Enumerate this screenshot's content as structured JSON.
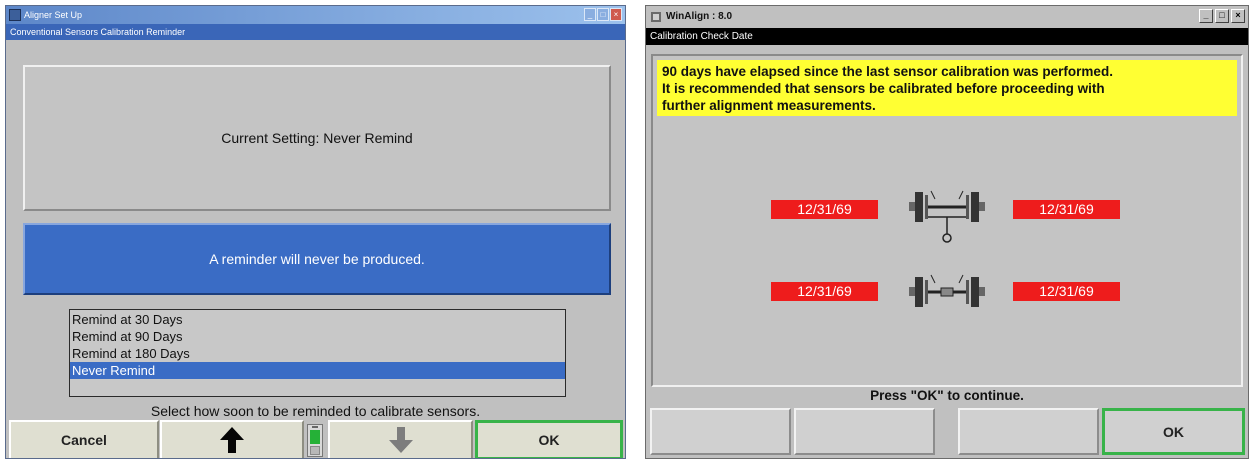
{
  "left_window": {
    "title": "Aligner Set Up",
    "subtitle": "Conventional Sensors Calibration Reminder",
    "current_setting": "Current Setting:  Never Remind",
    "reminder_message": "A reminder will never be produced.",
    "options": [
      {
        "label": "Remind at 30 Days",
        "selected": false
      },
      {
        "label": "Remind at 90 Days",
        "selected": false
      },
      {
        "label": "Remind at 180 Days",
        "selected": false
      },
      {
        "label": "Never Remind",
        "selected": true
      }
    ],
    "instruction": "Select how soon to be reminded to calibrate sensors.",
    "buttons": {
      "cancel": "Cancel",
      "up_icon": "arrow-up-icon",
      "down_icon": "arrow-down-icon",
      "ok": "OK"
    },
    "colors": {
      "accent": "#3a6cc5",
      "ok_border": "#38b349",
      "indicator": "#25b137"
    }
  },
  "right_window": {
    "title": "WinAlign : 8.0",
    "subtitle": "Calibration Check Date",
    "notice_lines": [
      "90 days have elapsed since the last sensor calibration was performed.",
      "It is recommended that sensors be calibrated before proceeding with",
      "further alignment measurements."
    ],
    "front_axle": {
      "left_date": "12/31/69",
      "right_date": "12/31/69",
      "icon": "front-axle-icon"
    },
    "rear_axle": {
      "left_date": "12/31/69",
      "right_date": "12/31/69",
      "icon": "rear-axle-icon"
    },
    "continue_text": "Press \"OK\" to continue.",
    "buttons": {
      "ok": "OK"
    },
    "colors": {
      "notice_bg": "#ffff33",
      "date_badge": "#ee1c1c",
      "ok_border": "#38b349"
    }
  }
}
